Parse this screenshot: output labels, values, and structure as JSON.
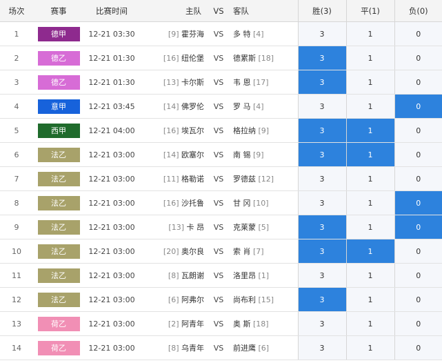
{
  "headers": {
    "no": "场次",
    "league": "赛事",
    "time": "比赛时间",
    "home": "主队",
    "vs": "VS",
    "away": "客队",
    "win": "胜(3)",
    "draw": "平(1)",
    "lose": "负(0)"
  },
  "colors": {
    "德甲": "#8e2a8e",
    "德乙": "#d76cd6",
    "意甲": "#1762db",
    "西甲": "#1f6b2c",
    "法乙": "#a8a26a",
    "荷乙": "#f18fb5",
    "selected": "#2d82dd"
  },
  "matches": [
    {
      "no": "1",
      "league": "德甲",
      "time": "12-21 03:30",
      "home_rank": "[9]",
      "home": "霍芬海",
      "vs": "VS",
      "away": "多 特",
      "away_rank": "[4]",
      "win": "3",
      "draw": "1",
      "lose": "0",
      "selected": []
    },
    {
      "no": "2",
      "league": "德乙",
      "time": "12-21 01:30",
      "home_rank": "[16]",
      "home": "纽伦堡",
      "vs": "VS",
      "away": "德累斯",
      "away_rank": "[18]",
      "win": "3",
      "draw": "1",
      "lose": "0",
      "selected": [
        "win"
      ]
    },
    {
      "no": "3",
      "league": "德乙",
      "time": "12-21 01:30",
      "home_rank": "[13]",
      "home": "卡尔斯",
      "vs": "VS",
      "away": "韦 恩",
      "away_rank": "[17]",
      "win": "3",
      "draw": "1",
      "lose": "0",
      "selected": [
        "win"
      ]
    },
    {
      "no": "4",
      "league": "意甲",
      "time": "12-21 03:45",
      "home_rank": "[14]",
      "home": "佛罗伦",
      "vs": "VS",
      "away": "罗 马",
      "away_rank": "[4]",
      "win": "3",
      "draw": "1",
      "lose": "0",
      "selected": [
        "lose"
      ]
    },
    {
      "no": "5",
      "league": "西甲",
      "time": "12-21 04:00",
      "home_rank": "[16]",
      "home": "埃瓦尔",
      "vs": "VS",
      "away": "格拉纳",
      "away_rank": "[9]",
      "win": "3",
      "draw": "1",
      "lose": "0",
      "selected": [
        "win",
        "draw"
      ]
    },
    {
      "no": "6",
      "league": "法乙",
      "time": "12-21 03:00",
      "home_rank": "[14]",
      "home": "欧塞尔",
      "vs": "VS",
      "away": "南 锡",
      "away_rank": "[9]",
      "win": "3",
      "draw": "1",
      "lose": "0",
      "selected": [
        "win",
        "draw"
      ]
    },
    {
      "no": "7",
      "league": "法乙",
      "time": "12-21 03:00",
      "home_rank": "[11]",
      "home": "格勒诺",
      "vs": "VS",
      "away": "罗德兹",
      "away_rank": "[12]",
      "win": "3",
      "draw": "1",
      "lose": "0",
      "selected": []
    },
    {
      "no": "8",
      "league": "法乙",
      "time": "12-21 03:00",
      "home_rank": "[16]",
      "home": "沙托鲁",
      "vs": "VS",
      "away": "甘 冈",
      "away_rank": "[10]",
      "win": "3",
      "draw": "1",
      "lose": "0",
      "selected": [
        "lose"
      ]
    },
    {
      "no": "9",
      "league": "法乙",
      "time": "12-21 03:00",
      "home_rank": "[13]",
      "home": "卡 昂",
      "vs": "VS",
      "away": "克莱蒙",
      "away_rank": "[5]",
      "win": "3",
      "draw": "1",
      "lose": "0",
      "selected": [
        "win",
        "lose"
      ]
    },
    {
      "no": "10",
      "league": "法乙",
      "time": "12-21 03:00",
      "home_rank": "[20]",
      "home": "奥尔良",
      "vs": "VS",
      "away": "索 肖",
      "away_rank": "[7]",
      "win": "3",
      "draw": "1",
      "lose": "0",
      "selected": [
        "win",
        "draw"
      ]
    },
    {
      "no": "11",
      "league": "法乙",
      "time": "12-21 03:00",
      "home_rank": "[8]",
      "home": "瓦朗谢",
      "vs": "VS",
      "away": "洛里昂",
      "away_rank": "[1]",
      "win": "3",
      "draw": "1",
      "lose": "0",
      "selected": []
    },
    {
      "no": "12",
      "league": "法乙",
      "time": "12-21 03:00",
      "home_rank": "[6]",
      "home": "阿弗尔",
      "vs": "VS",
      "away": "尚布利",
      "away_rank": "[15]",
      "win": "3",
      "draw": "1",
      "lose": "0",
      "selected": [
        "win"
      ]
    },
    {
      "no": "13",
      "league": "荷乙",
      "time": "12-21 03:00",
      "home_rank": "[2]",
      "home": "阿青年",
      "vs": "VS",
      "away": "奥 斯",
      "away_rank": "[18]",
      "win": "3",
      "draw": "1",
      "lose": "0",
      "selected": []
    },
    {
      "no": "14",
      "league": "荷乙",
      "time": "12-21 03:00",
      "home_rank": "[8]",
      "home": "乌青年",
      "vs": "VS",
      "away": "前进鹰",
      "away_rank": "[6]",
      "win": "3",
      "draw": "1",
      "lose": "0",
      "selected": []
    }
  ]
}
